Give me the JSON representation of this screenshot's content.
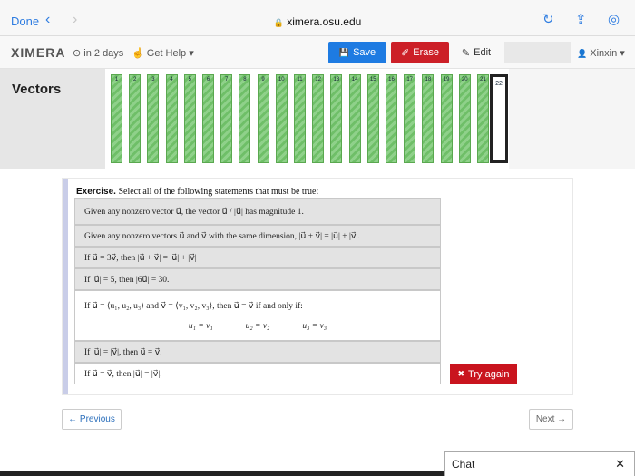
{
  "browser": {
    "done_label": "Done",
    "back_glyph": "‹",
    "forward_glyph": "›",
    "url": "ximera.osu.edu",
    "lock_glyph": "🔒",
    "reload_glyph": "↻",
    "share_glyph": "⇪",
    "compass_glyph": "◎"
  },
  "nav": {
    "logo": "XIMERA",
    "due": "⊙ in 2 days",
    "help": "Get Help ▾",
    "save_label": "Save",
    "erase_label": "Erase",
    "edit_label": "Edit",
    "user_label": "Xinxin ▾"
  },
  "icons": {
    "save": "💾",
    "erase": "✐",
    "edit": "✎",
    "help": "☝",
    "user": "👤",
    "try": "✖"
  },
  "page": {
    "title": "Vectors",
    "current_activity": "22",
    "activity_numbers": [
      "1",
      "2",
      "3",
      "4",
      "5",
      "6",
      "7",
      "8",
      "9",
      "10",
      "11",
      "12",
      "13",
      "14",
      "15",
      "16",
      "17",
      "18",
      "19",
      "20",
      "21"
    ]
  },
  "exercise": {
    "label": "Exercise.",
    "prompt": "Select all of the following statements that must be true:",
    "statements": [
      "Given any nonzero vector u⃗, the vector u⃗ / |u⃗| has magnitude 1.",
      "Given any nonzero vectors u⃗ and v⃗ with the same dimension, |u⃗ + v⃗| = |u⃗| + |v⃗|.",
      "If u⃗ = 3v⃗, then |u⃗ + v⃗| = |u⃗| + |v⃗|",
      "If |u⃗| = 5, then |6u⃗| = 30.",
      "If u⃗ = ⟨u₁, u₂, u₃⟩ and v⃗ = ⟨v₁, v₂, v₃⟩, then u⃗ = v⃗ if and only if:",
      "If |u⃗| = |v⃗|, then u⃗ = v⃗.",
      "If u⃗ = v⃗, then |u⃗| = |v⃗|."
    ],
    "conditions": [
      "u₁ = v₁",
      "u₂ = v₂",
      "u₃ = v₃"
    ],
    "try_again_label": "Try again"
  },
  "pagination": {
    "previous_label": "← Previous",
    "next_label": "Next →"
  },
  "chat": {
    "label": "Chat",
    "close_glyph": "✕"
  },
  "colors": {
    "accent_blue": "#1e7be2",
    "danger_red": "#cc1f27",
    "tile_green": "#6fbf68"
  }
}
